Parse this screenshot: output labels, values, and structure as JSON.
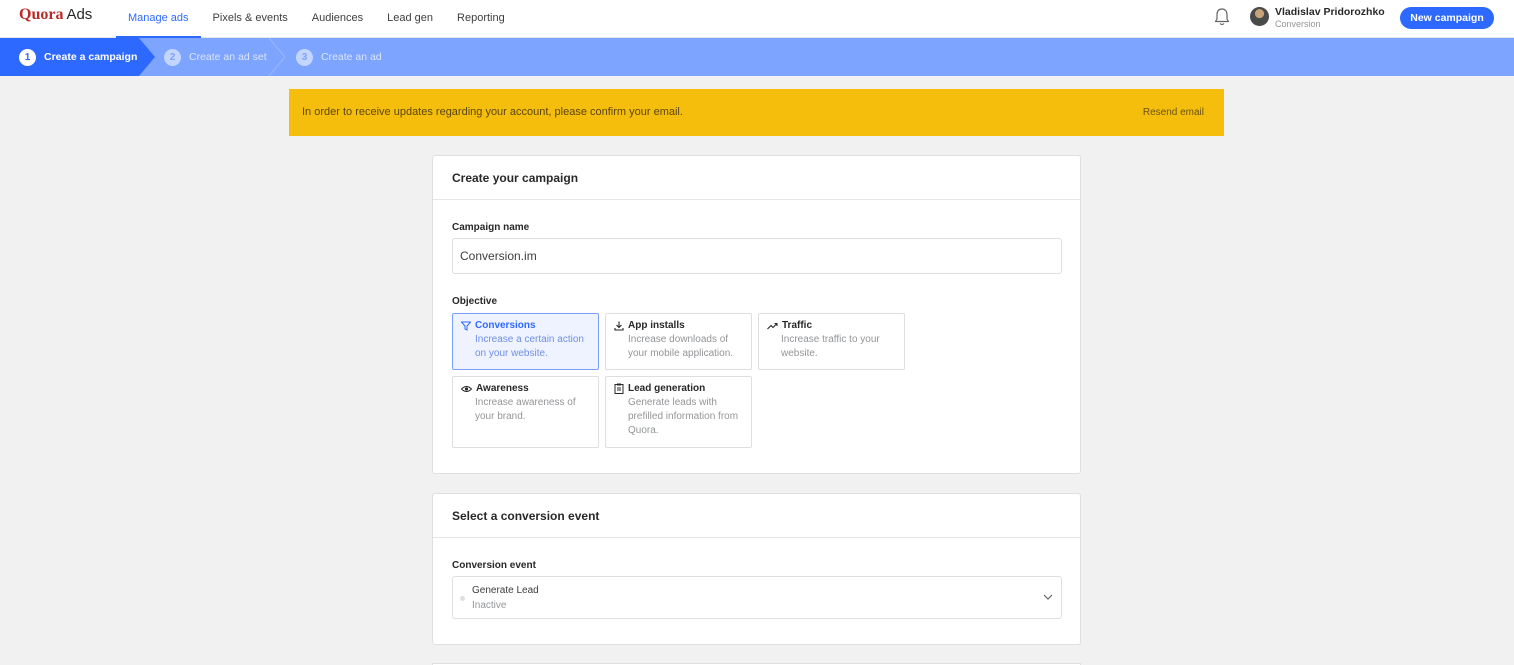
{
  "nav": {
    "logo_brand": "Quora",
    "logo_product": "Ads",
    "links": [
      {
        "label": "Manage ads",
        "active": true
      },
      {
        "label": "Pixels & events",
        "active": false
      },
      {
        "label": "Audiences",
        "active": false
      },
      {
        "label": "Lead gen",
        "active": false
      },
      {
        "label": "Reporting",
        "active": false
      }
    ],
    "user_name": "Vladislav Pridorozhko",
    "user_account": "Conversion",
    "new_campaign_label": "New campaign"
  },
  "steps": [
    {
      "num": "1",
      "label": "Create a campaign",
      "active": true
    },
    {
      "num": "2",
      "label": "Create an ad set",
      "active": false
    },
    {
      "num": "3",
      "label": "Create an ad",
      "active": false
    }
  ],
  "banner": {
    "message": "In order to receive updates regarding your account, please confirm your email.",
    "action": "Resend email",
    "color": "#f5bd0c"
  },
  "campaign": {
    "header": "Create your campaign",
    "name_label": "Campaign name",
    "name_value": "Conversion.im",
    "objective_label": "Objective",
    "objectives": [
      {
        "title": "Conversions",
        "desc": "Increase a certain action on your website.",
        "icon": "funnel-icon",
        "selected": true
      },
      {
        "title": "App installs",
        "desc": "Increase downloads of your mobile application.",
        "icon": "download-icon",
        "selected": false
      },
      {
        "title": "Traffic",
        "desc": "Increase traffic to your website.",
        "icon": "trending-up-icon",
        "selected": false
      },
      {
        "title": "Awareness",
        "desc": "Increase awareness of your brand.",
        "icon": "eye-icon",
        "selected": false
      },
      {
        "title": "Lead generation",
        "desc": "Generate leads with prefilled information from Quora.",
        "icon": "clipboard-icon",
        "selected": false
      }
    ]
  },
  "conversion": {
    "header": "Select a conversion event",
    "event_label": "Conversion event",
    "event_value": "Generate Lead",
    "event_status": "Inactive"
  },
  "colors": {
    "accent": "#2e69ff",
    "steps_bar": "#7da4ff",
    "brand": "#b92b27"
  }
}
